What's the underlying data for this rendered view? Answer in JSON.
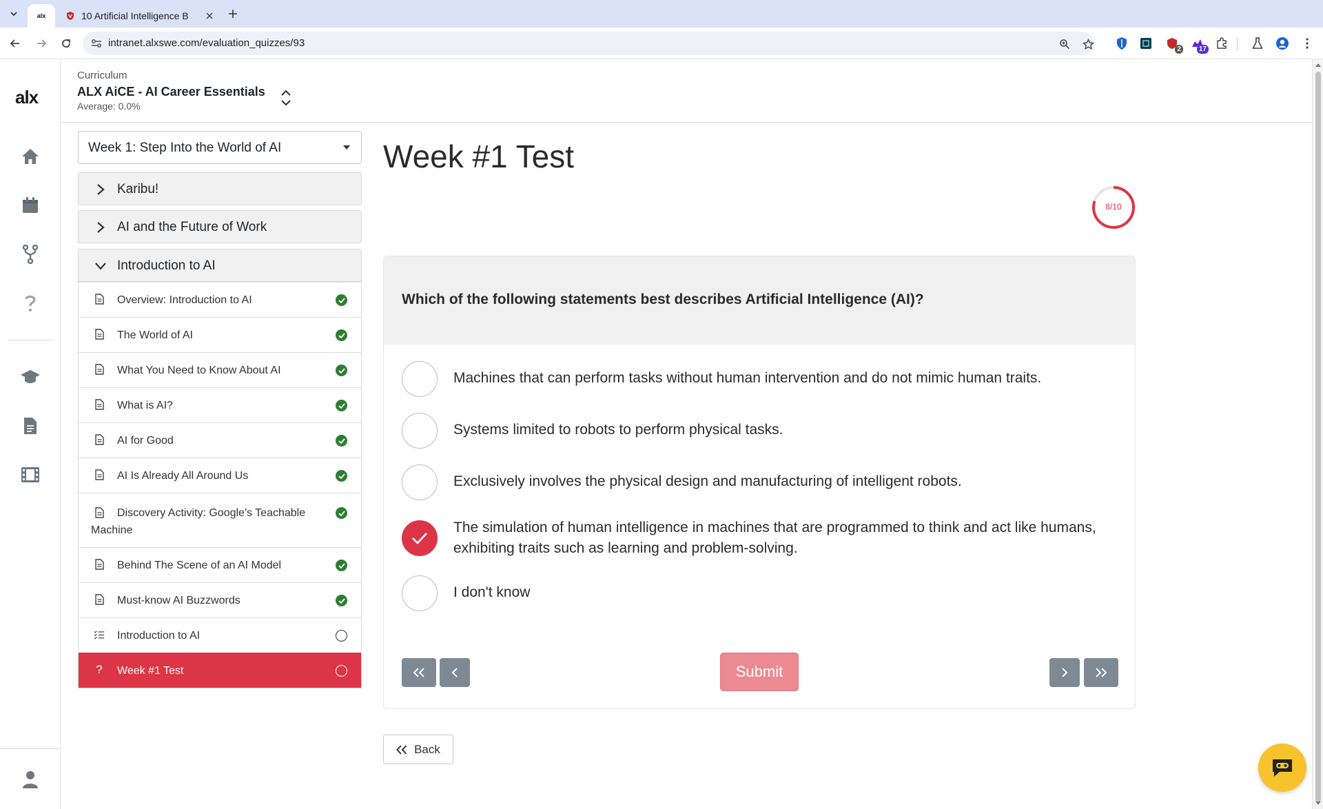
{
  "browser": {
    "tabs": [
      {
        "title": "",
        "favicon": "alx-favicon"
      },
      {
        "title": "10 Artificial Intelligence B",
        "favicon": "shield-favicon"
      }
    ],
    "url": "intranet.alxswe.com/evaluation_quizzes/93",
    "extensions": [
      {
        "icon": "shield-extension-icon"
      },
      {
        "icon": "grid-extension-icon"
      },
      {
        "icon": "security-extension-icon",
        "badge": "2"
      },
      {
        "icon": "extension-purple-icon",
        "badge": "17"
      },
      {
        "icon": "puzzle-icon"
      },
      {
        "icon": "labs-flask-icon"
      },
      {
        "icon": "profile-icon"
      },
      {
        "icon": "kebab-menu-icon"
      }
    ]
  },
  "rail": {
    "logo": "alx",
    "items": [
      "home-icon",
      "calendar-icon",
      "git-fork-icon",
      "help-icon",
      "graduation-cap-icon",
      "document-icon",
      "film-icon",
      "user-icon"
    ]
  },
  "header": {
    "label": "Curriculum",
    "curriculum_name": "ALX AiCE - AI Career Essentials",
    "average": "Average: 0.0%"
  },
  "sidebar": {
    "week": "Week 1: Step Into the World of AI",
    "sections": [
      {
        "label": "Karibu!",
        "expanded": false
      },
      {
        "label": "AI and the Future of Work",
        "expanded": false
      },
      {
        "label": "Introduction to AI",
        "expanded": true
      }
    ],
    "items": [
      {
        "label": "Overview: Introduction to AI",
        "icon": "document-icon",
        "status": "done"
      },
      {
        "label": "The World of AI",
        "icon": "document-icon",
        "status": "done"
      },
      {
        "label": "What You Need to Know About AI",
        "icon": "document-icon",
        "status": "done"
      },
      {
        "label": "What is AI?",
        "icon": "document-icon",
        "status": "done"
      },
      {
        "label": "AI for Good",
        "icon": "document-icon",
        "status": "done"
      },
      {
        "label": "AI Is Already All Around Us",
        "icon": "document-icon",
        "status": "done"
      },
      {
        "label": "Discovery Activity: Google's Teachable Machine",
        "icon": "document-icon",
        "status": "done"
      },
      {
        "label": "Behind The Scene of an AI Model",
        "icon": "document-icon",
        "status": "done"
      },
      {
        "label": "Must-know AI Buzzwords",
        "icon": "document-icon",
        "status": "done"
      },
      {
        "label": "Introduction to AI",
        "icon": "checklist-icon",
        "status": "todo"
      },
      {
        "label": "Week #1 Test",
        "icon": "question-icon",
        "status": "todo",
        "active": true
      }
    ]
  },
  "main": {
    "title": "Week #1 Test",
    "progress": {
      "label": "8/10",
      "current": 8,
      "total": 10
    },
    "question": "Which of the following statements best describes Artificial Intelligence (AI)?",
    "options": [
      {
        "text": "Machines that can perform tasks without human intervention and do not mimic human traits.",
        "selected": false
      },
      {
        "text": "Systems limited to robots to perform physical tasks.",
        "selected": false
      },
      {
        "text": "Exclusively involves the physical design and manufacturing of intelligent robots.",
        "selected": false
      },
      {
        "text": "The simulation of human intelligence in machines that are programmed to think and act like humans, exhibiting traits such as learning and problem-solving.",
        "selected": true
      },
      {
        "text": "I don't know",
        "selected": false
      }
    ],
    "submit_label": "Submit",
    "back_label": "Back"
  },
  "colors": {
    "accent": "#dc3545",
    "success": "#2e7d32",
    "chat": "#f8c22d"
  }
}
